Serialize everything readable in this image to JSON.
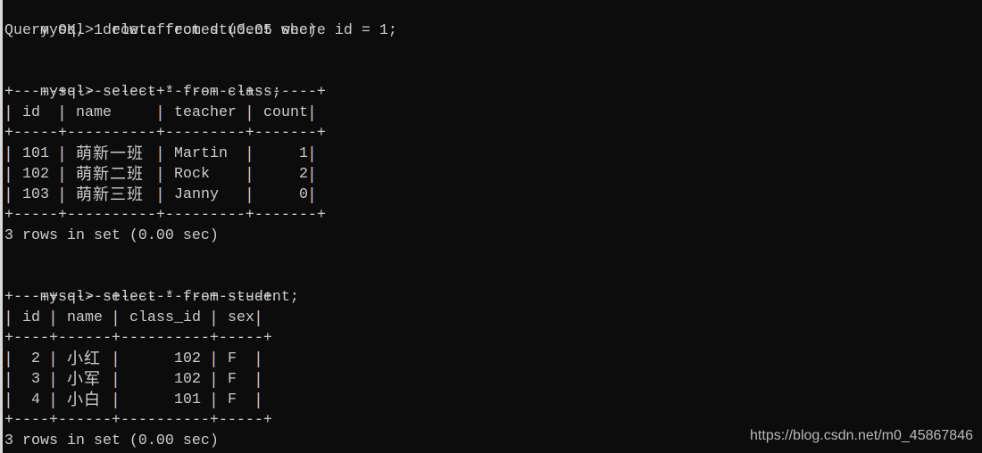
{
  "terminal": {
    "prompt": "mysql>",
    "commands": [
      {
        "input": "delete from student where id = 1;",
        "output": "Query OK, 1 row affected (0.05 sec)"
      },
      {
        "input": "select * from class;",
        "table": {
          "columns": [
            "id",
            "name",
            "teacher",
            "count"
          ],
          "rows": [
            [
              "101",
              "萌新一班",
              "Martin",
              "1"
            ],
            [
              "102",
              "萌新二班",
              "Rock",
              "2"
            ],
            [
              "103",
              "萌新三班",
              "Janny",
              "0"
            ]
          ]
        },
        "output": "3 rows in set (0.00 sec)"
      },
      {
        "input": "select * from student;",
        "table": {
          "columns": [
            "id",
            "name",
            "class_id",
            "sex"
          ],
          "rows": [
            [
              "2",
              "小红",
              "102",
              "F"
            ],
            [
              "3",
              "小军",
              "102",
              "F"
            ],
            [
              "4",
              "小白",
              "101",
              "F"
            ]
          ]
        },
        "output": "3 rows in set (0.00 sec)"
      }
    ]
  },
  "watermark": "https://blog.csdn.net/m0_45867846",
  "colors": {
    "background": "#0c0c0c",
    "text": "#cccccc"
  }
}
